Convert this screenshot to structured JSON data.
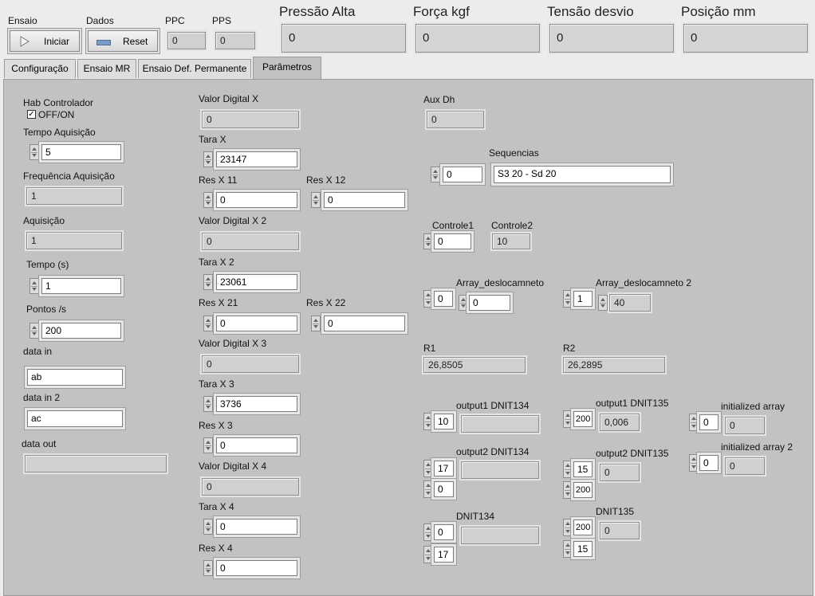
{
  "header": {
    "ensaio_label": "Ensaio",
    "dados_label": "Dados",
    "iniciar_label": "Iniciar",
    "reset_label": "Reset",
    "ppc_label": "PPC",
    "ppc_value": "0",
    "pps_label": "PPS",
    "pps_value": "0",
    "pressao_label": "Pressão Alta",
    "pressao_value": "0",
    "forca_label": "Força kgf",
    "forca_value": "0",
    "tensao_label": "Tensão desvio",
    "tensao_value": "0",
    "posicao_label": "Posição mm",
    "posicao_value": "0"
  },
  "tabs": [
    "Configuração",
    "Ensaio MR",
    "Ensaio Def. Permanente",
    "Parâmetros"
  ],
  "col1": {
    "hab_label": "Hab Controlador",
    "hab_check": "OFF/ON",
    "tempo_aq_label": "Tempo Aquisição",
    "tempo_aq_value": "5",
    "freq_label": "Frequência Aquisição",
    "freq_value": "1",
    "aquisicao_label": "Aquisição",
    "aquisicao_value": "1",
    "tempo_s_label": "Tempo (s)",
    "tempo_s_value": "1",
    "pontos_label": "Pontos /s",
    "pontos_value": "200",
    "data_in_label": "data in",
    "data_in_value": "ab",
    "data_in2_label": "data in 2",
    "data_in2_value": "ac",
    "data_out_label": "data out",
    "data_out_value": ""
  },
  "col2": {
    "vdx_label": "Valor Digital X",
    "vdx_value": "0",
    "tarax_label": "Tara X",
    "tarax_value": "23147",
    "resx11_label": "Res X 11",
    "resx11_value": "0",
    "resx12_label": "Res X 12",
    "resx12_value": "0",
    "vdx2_label": "Valor Digital X 2",
    "vdx2_value": "0",
    "tarax2_label": "Tara X 2",
    "tarax2_value": "23061",
    "resx21_label": "Res X 21",
    "resx21_value": "0",
    "resx22_label": "Res X 22",
    "resx22_value": "0",
    "vdx3_label": "Valor Digital X 3",
    "vdx3_value": "0",
    "tarax3_label": "Tara X 3",
    "tarax3_value": "3736",
    "resx3_label": "Res X 3",
    "resx3_value": "0",
    "vdx4_label": "Valor Digital X 4",
    "vdx4_value": "0",
    "tarax4_label": "Tara X 4",
    "tarax4_value": "0",
    "resx4_label": "Res X 4",
    "resx4_value": "0"
  },
  "col3": {
    "auxdh_label": "Aux Dh",
    "auxdh_value": "0",
    "seq_label": "Sequencias",
    "seq_index": "0",
    "seq_value": "S3 20 - Sd 20",
    "controle1_label": "Controle1",
    "controle1_value": "0",
    "controle2_label": "Controle2",
    "controle2_value": "10",
    "arr1_label": "Array_deslocamneto",
    "arr1_index": "0",
    "arr1_value": "0",
    "arr2_label": "Array_deslocamneto 2",
    "arr2_index": "1",
    "arr2_value": "40",
    "r1_label": "R1",
    "r1_value": "26,8505",
    "r2_label": "R2",
    "r2_value": "26,2895",
    "out1_134_label": "output1 DNIT134",
    "out1_134_index": "10",
    "out1_134_value": "",
    "out1_135_label": "output1 DNIT135",
    "out1_135_index": "200",
    "out1_135_value": "0,006",
    "init_label": "initialized array",
    "init_index": "0",
    "init_value": "0",
    "out2_134_label": "output2 DNIT134",
    "out2_134_index1": "17",
    "out2_134_index2": "0",
    "out2_134_value": "",
    "out2_135_label": "output2 DNIT135",
    "out2_135_index1": "15",
    "out2_135_index2": "200",
    "out2_135_value": "0",
    "init2_label": "initialized array 2",
    "init2_index": "0",
    "init2_value": "0",
    "dnit134_label": "DNIT134",
    "dnit134_index1": "0",
    "dnit134_index2": "17",
    "dnit134_value": "",
    "dnit135_label": "DNIT135",
    "dnit135_index1": "200",
    "dnit135_index2": "15",
    "dnit135_value": "0"
  }
}
